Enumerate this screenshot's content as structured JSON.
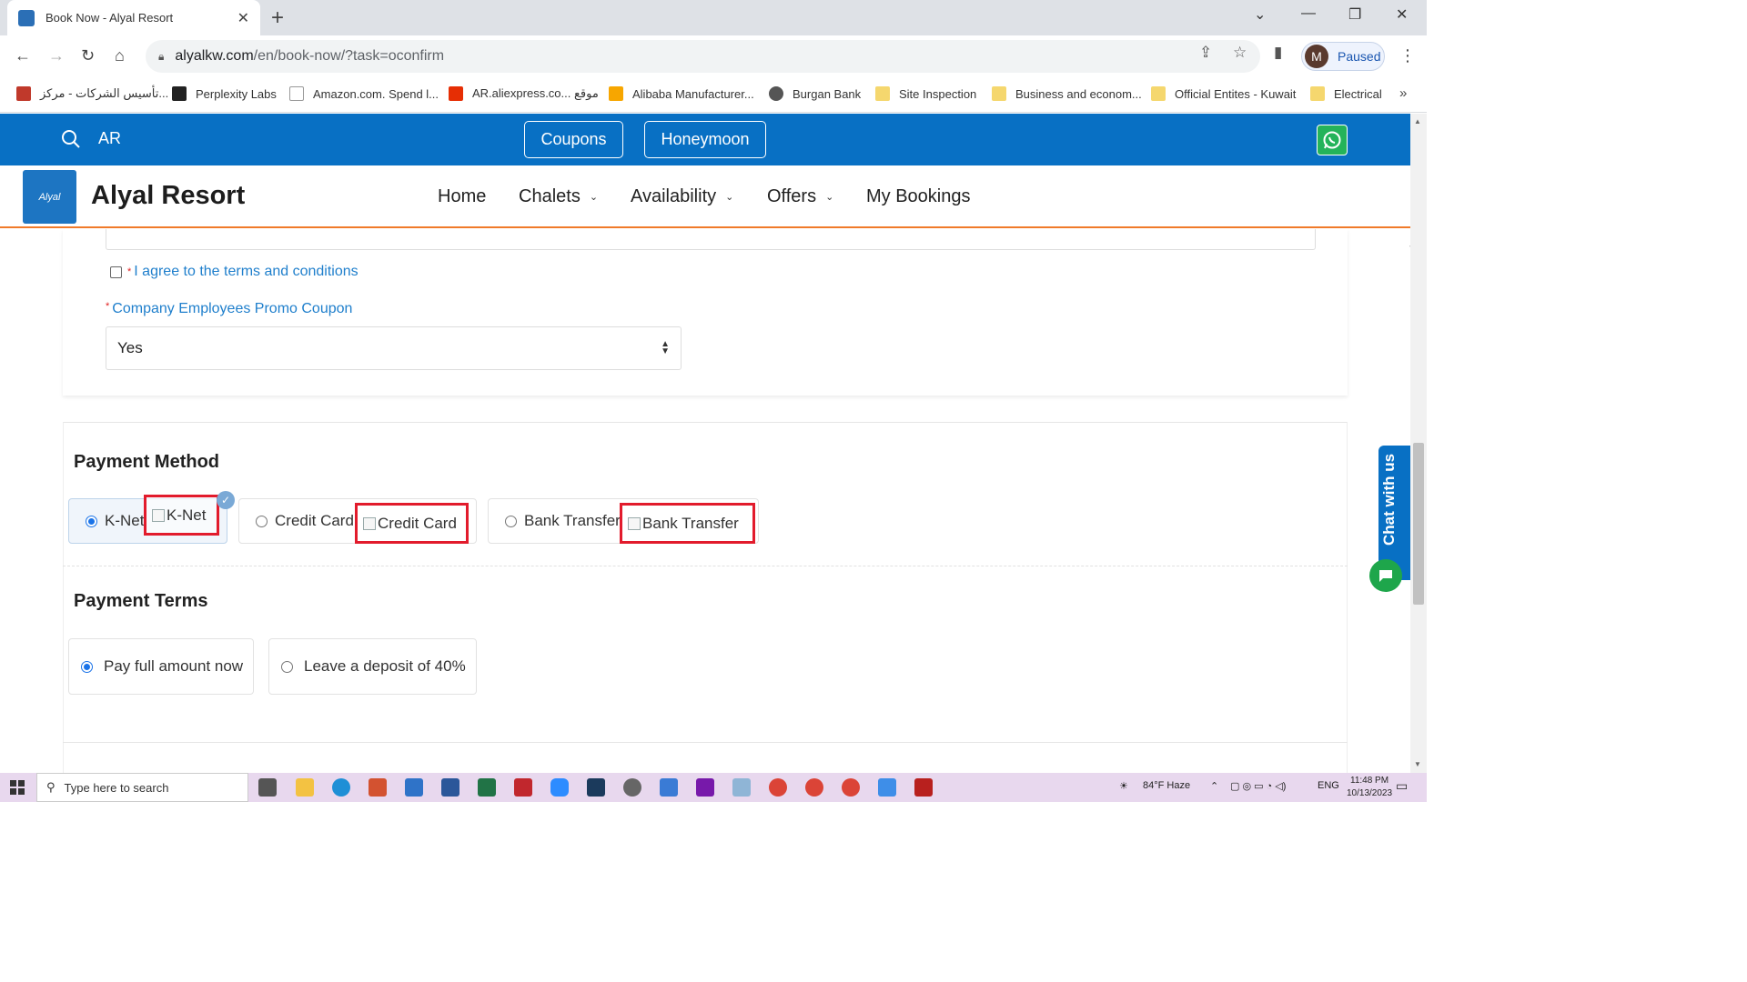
{
  "browser": {
    "tab_title": "Book Now - Alyal Resort",
    "url_host": "alyalkw.com",
    "url_path": "/en/book-now/?task=oconfirm",
    "profile_initial": "M",
    "profile_status": "Paused",
    "bookmarks": [
      {
        "label": "تأسيس الشركات - مركز...",
        "icon_color": "#c0392b"
      },
      {
        "label": "Perplexity Labs",
        "icon_color": "#222222"
      },
      {
        "label": "Amazon.com. Spend l...",
        "icon_color": "#ffffff"
      },
      {
        "label": "AR.aliexpress.co... موقع",
        "icon_color": "#e62e04"
      },
      {
        "label": "Alibaba Manufacturer...",
        "icon_color": "#f7a600"
      },
      {
        "label": "Burgan Bank",
        "icon_color": "#555555"
      },
      {
        "label": "Site Inspection",
        "icon_color": "#f5d76e"
      },
      {
        "label": "Business and econom...",
        "icon_color": "#f5d76e"
      },
      {
        "label": "Official Entites - Kuwait",
        "icon_color": "#f5d76e"
      },
      {
        "label": "Electrical",
        "icon_color": "#f5d76e"
      }
    ]
  },
  "site": {
    "lang": "AR",
    "coupons": "Coupons",
    "honeymoon": "Honeymoon",
    "brand": "Alyal Resort",
    "logo_text": "Alyal",
    "nav": {
      "home": "Home",
      "chalets": "Chalets",
      "availability": "Availability",
      "offers": "Offers",
      "bookings": "My Bookings"
    }
  },
  "form": {
    "terms_label": "I agree to the terms and conditions",
    "promo_label": "Company Employees Promo Coupon",
    "promo_value": "Yes",
    "required_mark": "*"
  },
  "payment_method": {
    "title": "Payment Method",
    "options": [
      {
        "label": "K-Net",
        "img_alt": "K-Net",
        "selected": true
      },
      {
        "label": "Credit Card",
        "img_alt": "Credit Card",
        "selected": false
      },
      {
        "label": "Bank Transfer",
        "img_alt": "Bank Transfer",
        "selected": false
      }
    ]
  },
  "payment_terms": {
    "title": "Payment Terms",
    "options": [
      {
        "label": "Pay full amount now",
        "selected": true
      },
      {
        "label": "Leave a deposit of 40%",
        "selected": false
      }
    ]
  },
  "chat": {
    "label": "Chat with us"
  },
  "taskbar": {
    "search_placeholder": "Type here to search",
    "weather": "84°F  Haze",
    "lang": "ENG",
    "time": "11:48 PM",
    "date": "10/13/2023"
  },
  "colors": {
    "brand_blue": "#0870c4",
    "accent_orange": "#f07a2a",
    "highlight_red": "#e21b2c",
    "link_blue": "#1f7fcc"
  }
}
